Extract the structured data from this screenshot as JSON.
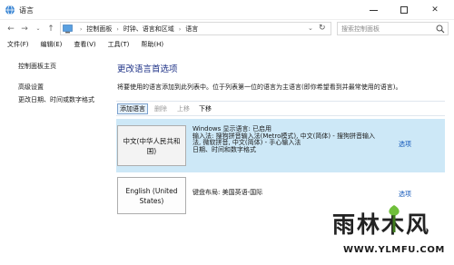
{
  "window": {
    "title": "语言",
    "minimize_icon": "minimize-icon",
    "maximize_icon": "maximize-icon",
    "close_label": "✕"
  },
  "address_bar": {
    "crumbs": [
      "控制面板",
      "时钟、语言和区域",
      "语言"
    ],
    "search_placeholder": "搜索控制面板"
  },
  "menu": {
    "items": [
      "文件(F)",
      "编辑(E)",
      "查看(V)",
      "工具(T)",
      "帮助(H)"
    ]
  },
  "sidebar": {
    "home": "控制面板主页",
    "links": [
      "高级设置",
      "更改日期、时间或数字格式"
    ]
  },
  "main": {
    "title": "更改语言首选项",
    "description": "将要使用的语言添加到此列表中。位于列表第一位的语言为主语言(即你希望看到并最常使用的语言)。",
    "toolbar": {
      "add": "添加语言",
      "remove": "删除",
      "up": "上移",
      "down": "下移"
    },
    "languages": [
      {
        "name": "中文(中华人民共和国)",
        "details": [
          "Windows 显示语言: 已启用",
          "输入法: 搜狗拼音输入法(Metro模式), 中文(简体) - 搜狗拼音输入",
          "法, 微软拼音, 中文(简体) - 手心输入法",
          "日期、时间和数字格式"
        ],
        "options": "选项"
      },
      {
        "name": "English (United States)",
        "details": [
          "键盘布局: 美国英语-国际"
        ],
        "options": "选项"
      }
    ]
  },
  "watermark": {
    "main": "雨林木风",
    "url": "WWW.YLMFU.COM"
  },
  "colors": {
    "accent_title": "#1e3287",
    "link": "#0f55b8",
    "selected_row": "#cde8f7"
  }
}
